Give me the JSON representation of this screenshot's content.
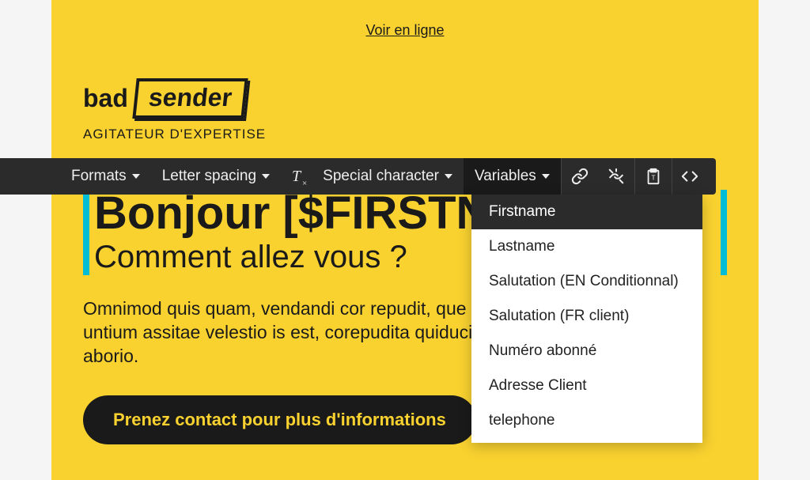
{
  "preview": {
    "view_online": "Voir en ligne",
    "logo_bad": "bad",
    "logo_sender": "sender",
    "tagline": "AGITATEUR D'EXPERTISE",
    "headline": "Bonjour [$FIRSTNAME]",
    "subhead": "Comment allez vous ?",
    "body": "Omnimod quis quam, vendandi cor repudit, que molorum harchil luptam untium assitae velestio is est, corepudita quiducit ut plit re, alitatio quati aborio.",
    "cta": "Prenez contact pour plus d'informations"
  },
  "toolbar": {
    "formats": "Formats",
    "letter_spacing": "Letter spacing",
    "special_char": "Special character",
    "variables": "Variables"
  },
  "dropdown": {
    "items": [
      "Firstname",
      "Lastname",
      "Salutation (EN Conditionnal)",
      "Salutation (FR client)",
      "Numéro abonné",
      "Adresse Client",
      " telephone"
    ]
  }
}
